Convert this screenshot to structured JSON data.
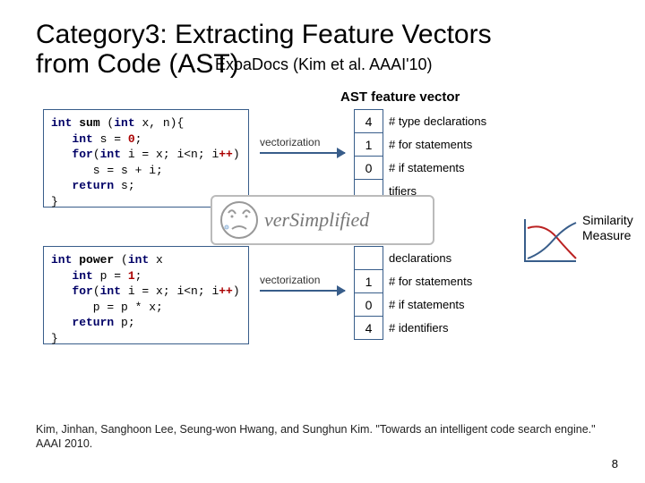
{
  "title_line1": "Category3: Extracting Feature Vectors",
  "title_line2": "from Code (AST)",
  "subtitle": "ExoaDocs (Kim et al. AAAI'10)",
  "ast_label": "AST feature vector",
  "vectorization_label": "vectorization",
  "code1": {
    "l1_kw1": "int",
    "l1_fn": "sum",
    "l1_rest_a": " (",
    "l1_kw2": "int",
    "l1_rest_b": " x, n){",
    "l2_kw": "int",
    "l2_mid": " s = ",
    "l2_num": "0",
    "l2_end": ";",
    "l3_kw1": "for",
    "l3_a": "(",
    "l3_kw2": "int",
    "l3_b": " i = x; i<n; i",
    "l3_op": "++",
    "l3_c": ")",
    "l4": "      s = s + i;",
    "l5_kw": "return",
    "l5_rest": " s;",
    "l6": "}"
  },
  "code2": {
    "l1_kw1": "int",
    "l1_fn": "power",
    "l1_rest_a": " (",
    "l1_kw2": "int",
    "l1_rest_b": " x",
    "l2_kw": "int",
    "l2_mid": " p = ",
    "l2_num": "1",
    "l2_end": ";",
    "l3_kw1": "for",
    "l3_a": "(",
    "l3_kw2": "int",
    "l3_b": " i = x; i<n; i",
    "l3_op": "++",
    "l3_c": ")",
    "l4": "      p = p * x;",
    "l5_kw": "return",
    "l5_rest": " p;",
    "l6": "}"
  },
  "features1": [
    {
      "val": "4",
      "label": "# type declarations"
    },
    {
      "val": "1",
      "label": "# for statements"
    },
    {
      "val": "0",
      "label": "# if statements"
    },
    {
      "val": "",
      "label": "tifiers"
    }
  ],
  "features2": [
    {
      "val": "",
      "label": "declarations"
    },
    {
      "val": "1",
      "label": "# for statements"
    },
    {
      "val": "0",
      "label": "# if statements"
    },
    {
      "val": "4",
      "label": "# identifiers"
    }
  ],
  "over_text": "verSimplified",
  "similarity_label": "Similarity\nMeasure",
  "citation": "Kim, Jinhan, Sanghoon Lee, Seung-won Hwang, and Sunghun Kim. \"Towards an intelligent code search engine.\" AAAI 2010.",
  "pagenum": "8"
}
